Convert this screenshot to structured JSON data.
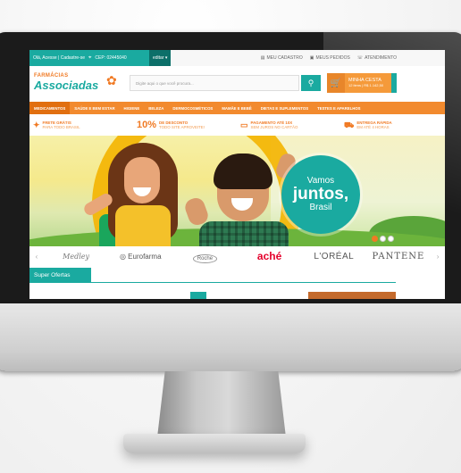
{
  "topbar": {
    "greeting": "Olá, Acesse | Cadastre-se",
    "cep": "CEP: 02445040",
    "edit": "editar",
    "my_account": "MEU CADASTRO",
    "my_orders": "MEUS PEDIDOS",
    "support": "ATENDIMENTO"
  },
  "header": {
    "logo_top": "FARMÁCIAS",
    "logo_main": "Associadas",
    "search_placeholder": "Digite aqui o que você procura...",
    "cart_title": "MINHA CESTA",
    "cart_sub": "12 itens | R$ 1.142,50"
  },
  "nav": {
    "items": [
      "MEDICAMENTOS",
      "SAÚDE E BEM ESTAR",
      "HIGIENE",
      "BELEZA",
      "DERMOCOSMÉTICOS",
      "MAMÃE E BEBÊ",
      "DIETAS E SUPLEMENTOS",
      "TESTES E APARELHOS"
    ]
  },
  "benefits": [
    {
      "head": "FRETE GRÁTIS",
      "sub": "PARA TODO BRASIL"
    },
    {
      "big": "10%",
      "head": "DE DESCONTO",
      "sub": "TODO SITE APROVEITE!"
    },
    {
      "head": "PAGAMENTO ATÉ 10X",
      "sub": "SEM JUROS NO CARTÃO"
    },
    {
      "head": "ENTREGA RÁPIDA",
      "sub": "EM ATÉ 4 HORAS"
    }
  ],
  "hero": {
    "line1": "Vamos",
    "line2": "juntos,",
    "line3": "Brasil"
  },
  "brands": [
    "Medley",
    "Eurofarma",
    "Roche",
    "aché",
    "L'ORÉAL",
    "PANTENE"
  ],
  "offers": {
    "tab": "Super Ofertas"
  },
  "colors": {
    "teal": "#1aaaa0",
    "orange": "#f28a2e"
  }
}
